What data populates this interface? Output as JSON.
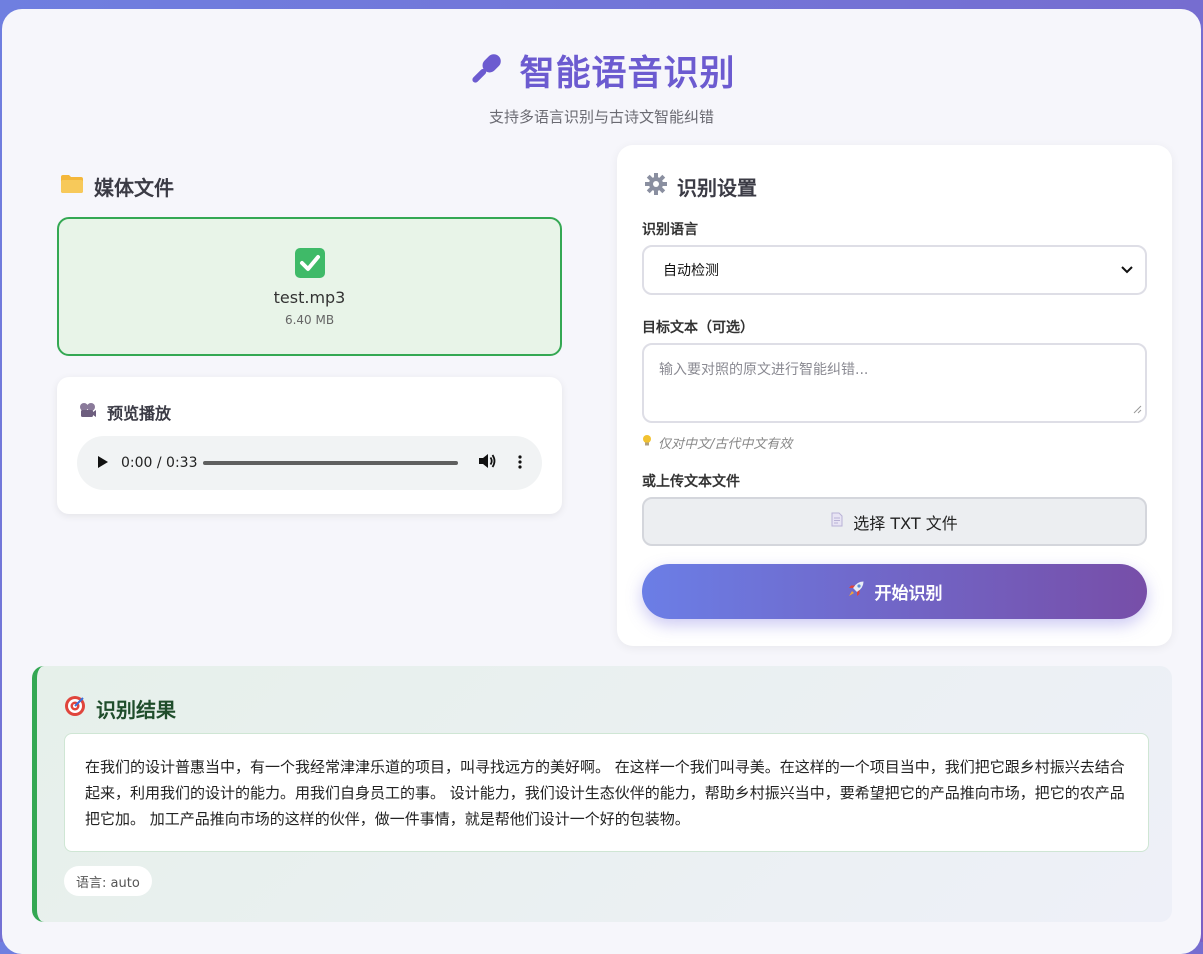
{
  "header": {
    "title": "智能语音识别",
    "subtitle": "支持多语言识别与古诗文智能纠错"
  },
  "media": {
    "section_title": "媒体文件",
    "file_name": "test.mp3",
    "file_size": "6.40 MB",
    "preview_title": "预览播放",
    "player": {
      "time": "0:00 / 0:33",
      "progress": 0
    }
  },
  "settings": {
    "section_title": "识别设置",
    "language_label": "识别语言",
    "language_value": "自动检测",
    "target_label": "目标文本（可选）",
    "target_placeholder": "输入要对照的原文进行智能纠错...",
    "hint": "仅对中文/古代中文有效",
    "upload_label": "或上传文本文件",
    "upload_button": "选择 TXT 文件",
    "start_button": "开始识别"
  },
  "result": {
    "section_title": "识别结果",
    "text": "在我们的设计普惠当中，有一个我经常津津乐道的项目，叫寻找远方的美好啊。 在这样一个我们叫寻美。在这样的一个项目当中，我们把它跟乡村振兴去结合起来，利用我们的设计的能力。用我们自身员工的事。 设计能力，我们设计生态伙伴的能力，帮助乡村振兴当中，要希望把它的产品推向市场，把它的农产品把它加。 加工产品推向市场的这样的伙伴，做一件事情，就是帮他们设计一个好的包装物。",
    "language_badge": "语言: auto"
  },
  "icons": {
    "title": "microphone-icon",
    "media": "folder-icon",
    "check": "check-icon",
    "preview": "film-projector-icon",
    "settings": "gear-icon",
    "hint": "lightbulb-icon",
    "file": "document-icon",
    "start": "rocket-icon",
    "result": "target-icon"
  },
  "colors": {
    "accent": "#6c5bd0",
    "success": "#34a853",
    "gradient_start": "#6b7ee6",
    "gradient_end": "#774ea8"
  }
}
